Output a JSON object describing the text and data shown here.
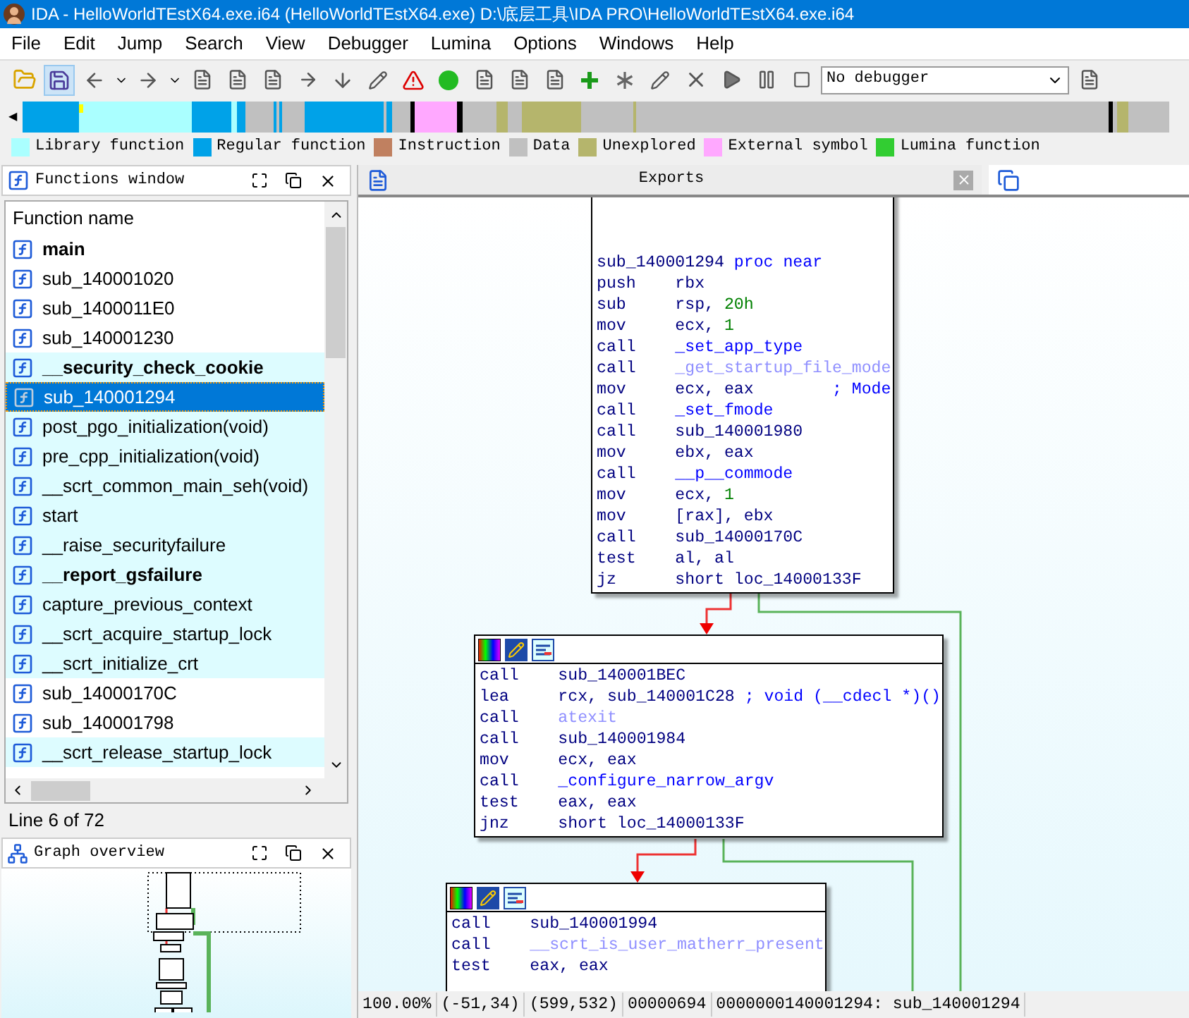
{
  "window": {
    "title": "IDA - HelloWorldTEstX64.exe.i64 (HelloWorldTEstX64.exe) D:\\底层工具\\IDA PRO\\HelloWorldTEstX64.exe.i64"
  },
  "menu": [
    "File",
    "Edit",
    "Jump",
    "Search",
    "View",
    "Debugger",
    "Lumina",
    "Options",
    "Windows",
    "Help"
  ],
  "toolbar": {
    "debugger": "No debugger"
  },
  "nav": {
    "back": "◀"
  },
  "legend": [
    {
      "label": "Library function",
      "color": "#aaffff"
    },
    {
      "label": "Regular function",
      "color": "#00a2e8"
    },
    {
      "label": "Instruction",
      "color": "#c08060"
    },
    {
      "label": "Data",
      "color": "#c0c0c0"
    },
    {
      "label": "Unexplored",
      "color": "#b5b56c"
    },
    {
      "label": "External symbol",
      "color": "#ffa8ff"
    },
    {
      "label": "Lumina function",
      "color": "#32cd32"
    }
  ],
  "functions_window": {
    "title": "Functions window",
    "column": "Function name",
    "rows": [
      {
        "name": "main",
        "kind": "regular",
        "bold": true,
        "selected": false
      },
      {
        "name": "sub_140001020",
        "kind": "regular",
        "bold": false,
        "selected": false
      },
      {
        "name": "sub_1400011E0",
        "kind": "regular",
        "bold": false,
        "selected": false
      },
      {
        "name": "sub_140001230",
        "kind": "regular",
        "bold": false,
        "selected": false
      },
      {
        "name": "__security_check_cookie",
        "kind": "library",
        "bold": true,
        "selected": false
      },
      {
        "name": "sub_140001294",
        "kind": "regular",
        "bold": false,
        "selected": true
      },
      {
        "name": "post_pgo_initialization(void)",
        "kind": "library",
        "bold": false,
        "selected": false
      },
      {
        "name": "pre_cpp_initialization(void)",
        "kind": "library",
        "bold": false,
        "selected": false
      },
      {
        "name": "__scrt_common_main_seh(void)",
        "kind": "library",
        "bold": false,
        "selected": false
      },
      {
        "name": "start",
        "kind": "library",
        "bold": false,
        "selected": false
      },
      {
        "name": "__raise_securityfailure",
        "kind": "library",
        "bold": false,
        "selected": false
      },
      {
        "name": "__report_gsfailure",
        "kind": "library",
        "bold": true,
        "selected": false
      },
      {
        "name": "capture_previous_context",
        "kind": "library",
        "bold": false,
        "selected": false
      },
      {
        "name": "__scrt_acquire_startup_lock",
        "kind": "library",
        "bold": false,
        "selected": false
      },
      {
        "name": "__scrt_initialize_crt",
        "kind": "library",
        "bold": false,
        "selected": false
      },
      {
        "name": "sub_14000170C",
        "kind": "regular",
        "bold": false,
        "selected": false
      },
      {
        "name": "sub_140001798",
        "kind": "regular",
        "bold": false,
        "selected": false
      },
      {
        "name": "__scrt_release_startup_lock",
        "kind": "library",
        "bold": false,
        "selected": false
      }
    ],
    "status": "Line 6 of 72"
  },
  "graph_overview": {
    "title": "Graph overview"
  },
  "tabs": [
    {
      "label": "Exports",
      "selected": false
    },
    {
      "selected": true
    }
  ],
  "graph": {
    "nodes": [
      {
        "header": false,
        "lines": [
          {
            "kind": "label",
            "op": "sub_140001294",
            "args": [
              {
                "text": "proc near",
                "kind": "kw"
              }
            ]
          },
          {
            "kind": "instr",
            "op": "push",
            "args": [
              {
                "text": "rbx",
                "kind": "reg"
              }
            ]
          },
          {
            "kind": "instr",
            "op": "sub",
            "args": [
              {
                "text": "rsp, ",
                "kind": "reg"
              },
              {
                "text": "20h",
                "kind": "num"
              }
            ]
          },
          {
            "kind": "instr",
            "op": "mov",
            "args": [
              {
                "text": "ecx, ",
                "kind": "reg"
              },
              {
                "text": "1",
                "kind": "num"
              }
            ]
          },
          {
            "kind": "instr",
            "op": "call",
            "args": [
              {
                "text": "_set_app_type",
                "kind": "name"
              }
            ]
          },
          {
            "kind": "instr",
            "op": "call",
            "args": [
              {
                "text": "_get_startup_file_mode",
                "kind": "import"
              }
            ]
          },
          {
            "kind": "instr",
            "op": "mov",
            "args": [
              {
                "text": "ecx, eax",
                "kind": "reg"
              },
              {
                "text": "; Mode",
                "kind": "comment"
              }
            ]
          },
          {
            "kind": "instr",
            "op": "call",
            "args": [
              {
                "text": "_set_fmode",
                "kind": "name"
              }
            ]
          },
          {
            "kind": "instr",
            "op": "call",
            "args": [
              {
                "text": "sub_140001980",
                "kind": "reg"
              }
            ]
          },
          {
            "kind": "instr",
            "op": "mov",
            "args": [
              {
                "text": "ebx, eax",
                "kind": "reg"
              }
            ]
          },
          {
            "kind": "instr",
            "op": "call",
            "args": [
              {
                "text": "__p__commode",
                "kind": "name"
              }
            ]
          },
          {
            "kind": "instr",
            "op": "mov",
            "args": [
              {
                "text": "ecx, ",
                "kind": "reg"
              },
              {
                "text": "1",
                "kind": "num"
              }
            ]
          },
          {
            "kind": "instr",
            "op": "mov",
            "args": [
              {
                "text": "[rax], ebx",
                "kind": "reg"
              }
            ]
          },
          {
            "kind": "instr",
            "op": "call",
            "args": [
              {
                "text": "sub_14000170C",
                "kind": "reg"
              }
            ]
          },
          {
            "kind": "instr",
            "op": "test",
            "args": [
              {
                "text": "al, al",
                "kind": "reg"
              }
            ]
          },
          {
            "kind": "instr",
            "op": "jz",
            "args": [
              {
                "text": "short loc_14000133F",
                "kind": "reg"
              }
            ]
          }
        ]
      },
      {
        "header": true,
        "lines": [
          {
            "kind": "instr",
            "op": "call",
            "args": [
              {
                "text": "sub_140001BEC",
                "kind": "reg"
              }
            ]
          },
          {
            "kind": "instr",
            "op": "lea",
            "args": [
              {
                "text": "rcx, sub_140001C28",
                "kind": "reg"
              },
              {
                "text": "; void (__cdecl *)()",
                "kind": "comment"
              }
            ]
          },
          {
            "kind": "instr",
            "op": "call",
            "args": [
              {
                "text": "atexit",
                "kind": "import"
              }
            ]
          },
          {
            "kind": "instr",
            "op": "call",
            "args": [
              {
                "text": "sub_140001984",
                "kind": "reg"
              }
            ]
          },
          {
            "kind": "instr",
            "op": "mov",
            "args": [
              {
                "text": "ecx, eax",
                "kind": "reg"
              }
            ]
          },
          {
            "kind": "instr",
            "op": "call",
            "args": [
              {
                "text": "_configure_narrow_argv",
                "kind": "name"
              }
            ]
          },
          {
            "kind": "instr",
            "op": "test",
            "args": [
              {
                "text": "eax, eax",
                "kind": "reg"
              }
            ]
          },
          {
            "kind": "instr",
            "op": "jnz",
            "args": [
              {
                "text": "short loc_14000133F",
                "kind": "reg"
              }
            ]
          }
        ]
      },
      {
        "header": true,
        "lines": [
          {
            "kind": "instr",
            "op": "call",
            "args": [
              {
                "text": "sub_140001994",
                "kind": "reg"
              }
            ]
          },
          {
            "kind": "instr",
            "op": "call",
            "args": [
              {
                "text": "__scrt_is_user_matherr_present",
                "kind": "import"
              }
            ]
          },
          {
            "kind": "instr",
            "op": "test",
            "args": [
              {
                "text": "eax, eax",
                "kind": "reg"
              }
            ]
          }
        ]
      }
    ]
  },
  "status_bar": [
    "100.00%",
    "(-51,34)",
    "(599,532)",
    "00000694",
    "0000000140001294: sub_140001294"
  ]
}
